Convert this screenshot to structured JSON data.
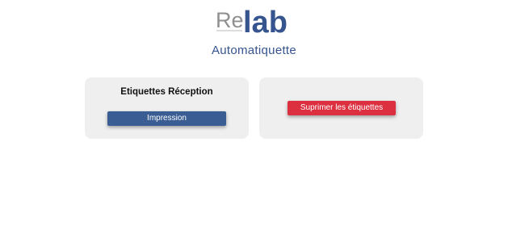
{
  "brand": {
    "logo_re": "Re",
    "logo_lab": "lab",
    "app_title": "Automatiquette"
  },
  "colors": {
    "primary_blue": "#3a5d94",
    "danger_red": "#dc3040",
    "card_bg": "#efefef",
    "title_blue": "#36558f"
  },
  "reception_card": {
    "heading": "Etiquettes Réception",
    "print_button": "Impression"
  },
  "delete_card": {
    "delete_button": "Suprimer les étiquettes"
  }
}
